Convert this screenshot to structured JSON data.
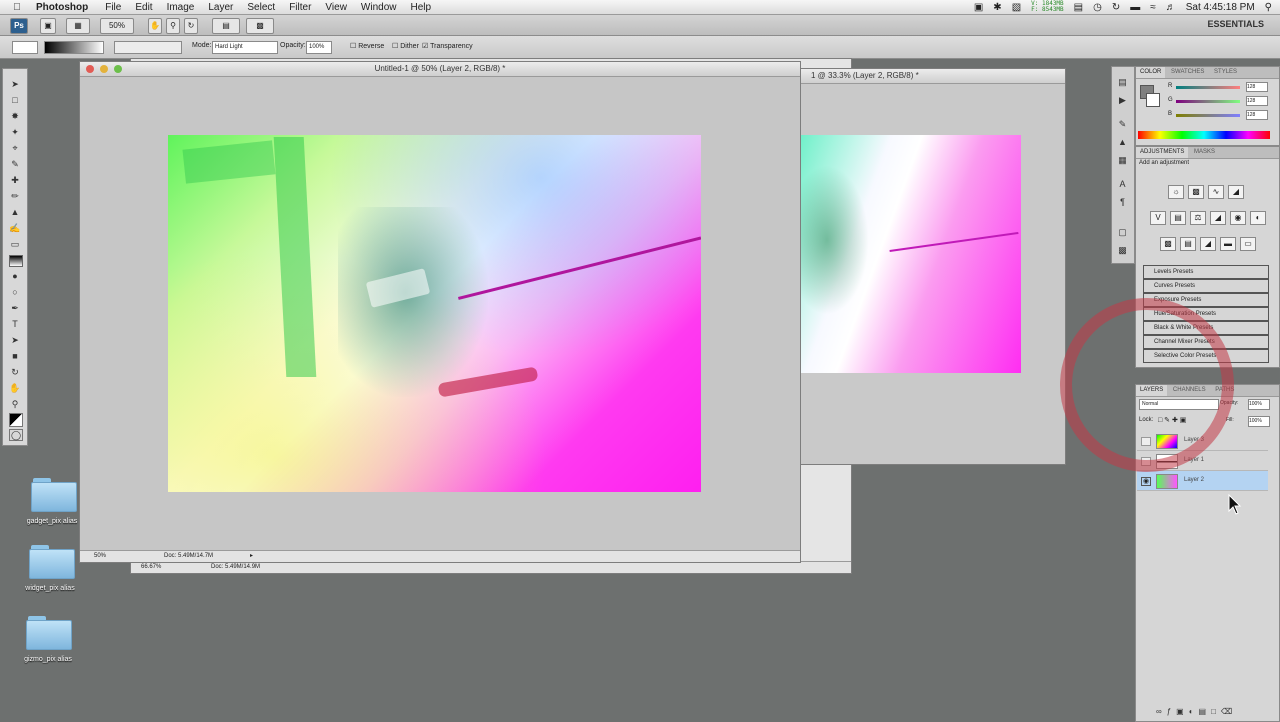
{
  "menubar": {
    "apple": "",
    "app_name": "Photoshop",
    "menus": [
      "File",
      "Edit",
      "Image",
      "Layer",
      "Select",
      "Filter",
      "View",
      "Window",
      "Help"
    ],
    "mem_line1": "V: 1843MB",
    "mem_line2": "F: 8543MB",
    "clock": "Sat 4:45:18 PM"
  },
  "appbar": {
    "ps_logo": "Ps",
    "zoom_value": "50%",
    "workspace": "ESSENTIALS"
  },
  "options": {
    "mode_label": "Mode:",
    "mode_value": "Hard Light",
    "opacity_label": "Opacity:",
    "opacity_value": "100%",
    "reverse_label": "Reverse",
    "dither_label": "Dither",
    "transparency_label": "Transparency"
  },
  "desktop_icons": [
    {
      "label": "gadget_pix alias"
    },
    {
      "label": "widget_pix alias"
    },
    {
      "label": "gizmo_pix alias"
    }
  ],
  "doc_main": {
    "title": "Untitled-1 @ 50% (Layer 2, RGB/8) *",
    "zoom": "50%",
    "doc_info": "Doc: 5.49M/14.7M"
  },
  "doc_back1": {
    "title": "1 @ 33.3% (Layer 2, RGB/8) *"
  },
  "doc_back2": {
    "zoom": "66.67%",
    "doc_info": "Doc: 5.49M/14.9M"
  },
  "color_panel": {
    "tabs": [
      "COLOR",
      "SWATCHES",
      "STYLES"
    ],
    "r_label": "R",
    "g_label": "G",
    "b_label": "B",
    "r_value": "128",
    "g_value": "128",
    "b_value": "128"
  },
  "adjustments_panel": {
    "tabs": [
      "ADJUSTMENTS",
      "MASKS"
    ],
    "caption": "Add an adjustment",
    "presets": [
      "Levels Presets",
      "Curves Presets",
      "Exposure Presets",
      "Hue/Saturation Presets",
      "Black & White Presets",
      "Channel Mixer Presets",
      "Selective Color Presets"
    ]
  },
  "layers_panel": {
    "tabs": [
      "LAYERS",
      "CHANNELS",
      "PATHS"
    ],
    "blend_mode": "Normal",
    "opacity_label": "Opacity:",
    "opacity_value": "100%",
    "lock_label": "Lock:",
    "fill_label": "Fill:",
    "fill_value": "100%",
    "layers": [
      {
        "name": "Layer 3"
      },
      {
        "name": "Layer 1"
      },
      {
        "name": "Layer 2"
      }
    ]
  },
  "colors": {
    "highlight_circle": "#c23b47",
    "selected_layer": "#b4d3f2",
    "desktop": "#6d706f"
  }
}
